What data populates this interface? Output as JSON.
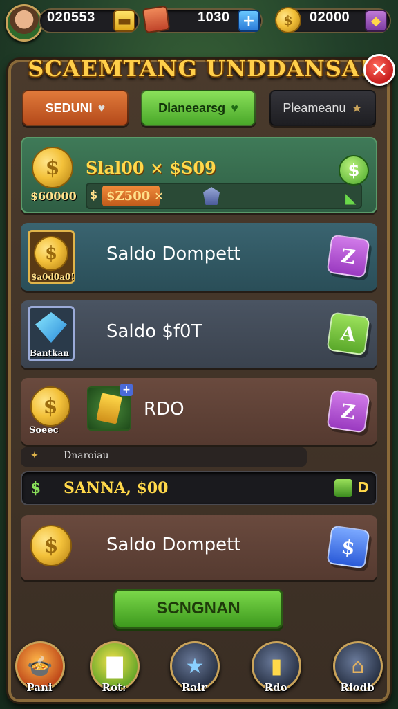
{
  "hud": {
    "player_balance": "020553",
    "center_value": "1030",
    "coins_value": "02000"
  },
  "dialog": {
    "title": "SCAEMTANG UNDDANSA!",
    "close_symbol": "✕"
  },
  "tabs": [
    {
      "label": "SEDUNI",
      "color": "#c9602a"
    },
    {
      "label": "Dlaneearsg",
      "color": "#5cc03a"
    },
    {
      "label": "Pleameanu",
      "color": "#2a2a2e"
    }
  ],
  "rows": {
    "featured": {
      "headline": "Slal00 × $S09",
      "coin_caption": "$60000",
      "progress_prefix": "$",
      "progress_value": "$Z500",
      "progress_close": "✕",
      "progress_fraction": 0.21,
      "badge": "$"
    },
    "wallet_one": {
      "label": "Saldo Dompett",
      "caption": "$a0d0a0!",
      "badge": "Z",
      "badge_color": "#b24ad8"
    },
    "gem_row": {
      "label": "Saldo $f0T",
      "caption": "Bantkan",
      "badge": "A",
      "badge_color": "#6cc03a"
    },
    "rdo_row": {
      "label": "RDO",
      "caption": "Soeec",
      "badge": "Z",
      "badge_color": "#b24ad8"
    },
    "wallet_two": {
      "label": "Saldo Dompett",
      "badge": "$",
      "badge_color": "#3a6ad8"
    }
  },
  "mini_bar": {
    "text": "Dnaroiau"
  },
  "search_bar": {
    "text": "SANNA, $00",
    "prefix": "$",
    "suffix": "D"
  },
  "primary_button": {
    "label": "SCNGNAN"
  },
  "bottom_nav": [
    {
      "label": "Pani"
    },
    {
      "label": "Rot:"
    },
    {
      "label": "Rair"
    },
    {
      "label": "Rdo"
    },
    {
      "label": "Riodb"
    }
  ]
}
